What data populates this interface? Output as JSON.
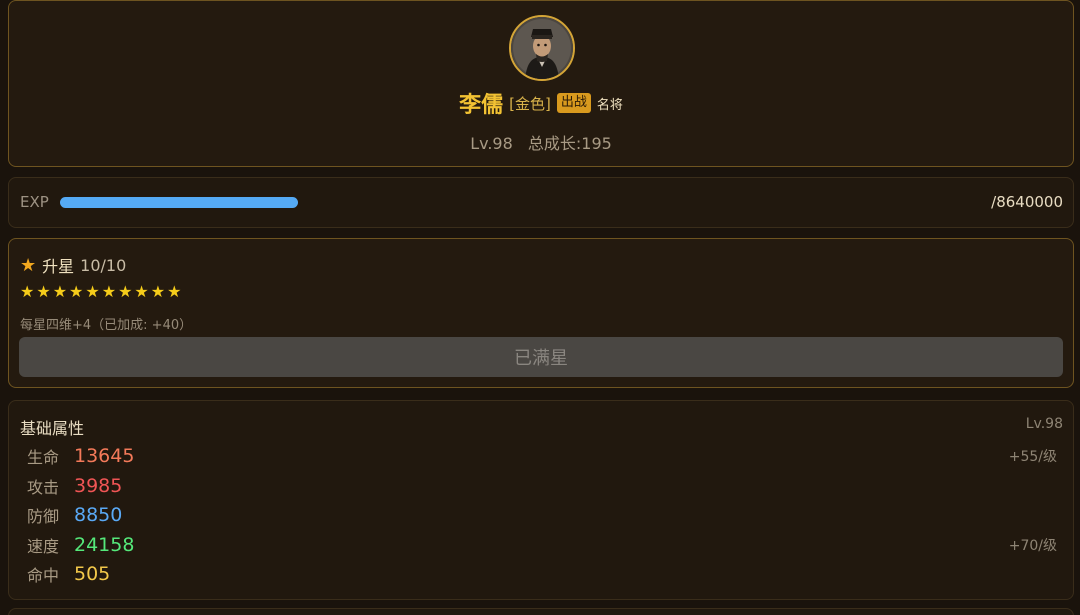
{
  "hero": {
    "name": "李儒",
    "quality": "[金色]",
    "battle_badge": "出战",
    "famous_badge": "名将",
    "level": "Lv.98",
    "total_growth": "总成长:195"
  },
  "exp": {
    "label": "EXP",
    "value_text": "/8640000",
    "progress": 0.27,
    "bar_color": "#55aaf5"
  },
  "star_up": {
    "icon": "star-icon",
    "title": "升星",
    "count": "10/10",
    "stars": [
      "★",
      "★",
      "★",
      "★",
      "★",
      "★",
      "★",
      "★",
      "★",
      "★"
    ],
    "bonus_text": "每星四维+4（已加成: +40）",
    "button_label": "已满星"
  },
  "attributes": {
    "title": "基础属性",
    "level": "Lv.98",
    "rows": [
      {
        "label": "生命",
        "value": "13645",
        "color": "#f47a5a",
        "growth": "+55/级"
      },
      {
        "label": "攻击",
        "value": "3985",
        "color": "#f05555",
        "growth": ""
      },
      {
        "label": "防御",
        "value": "8850",
        "color": "#5aa9f5",
        "growth": ""
      },
      {
        "label": "速度",
        "value": "24158",
        "color": "#55e87a",
        "growth": "+70/级"
      },
      {
        "label": "命中",
        "value": "505",
        "color": "#f2c84a",
        "growth": ""
      }
    ]
  }
}
